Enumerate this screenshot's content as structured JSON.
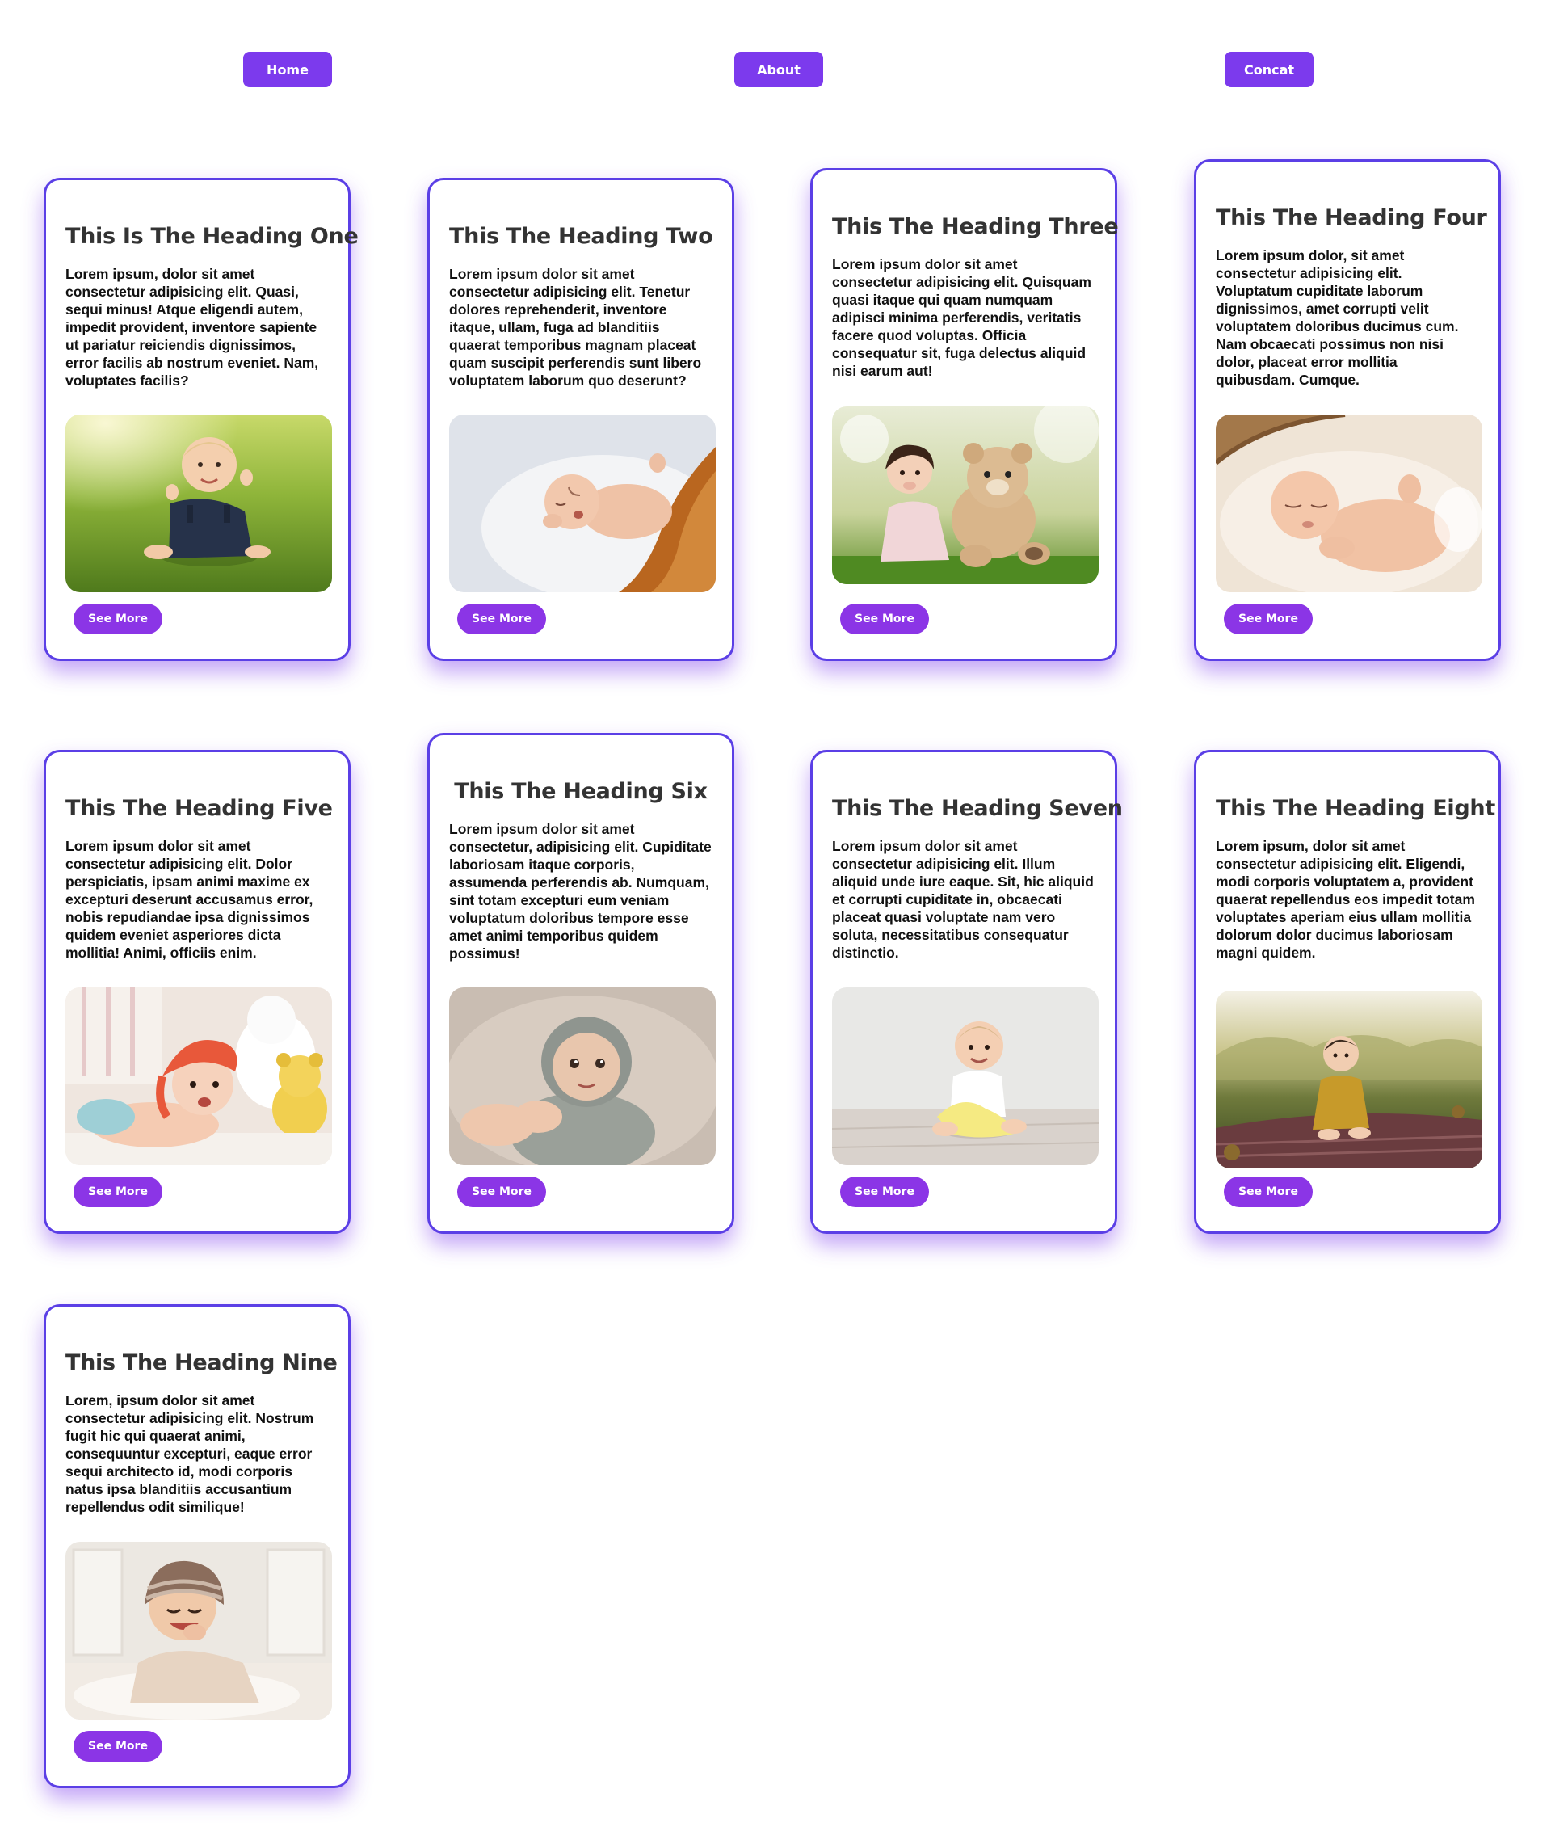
{
  "nav": {
    "home_label": "Home",
    "about_label": "About",
    "contact_label": "Concat"
  },
  "colors": {
    "accent": "#7c3aed",
    "card_border": "#5b3fe6",
    "card_shadow": "#8b5cf6",
    "heading": "#333333",
    "body_text": "#111111"
  },
  "cards": [
    {
      "heading": "This Is The Heading One",
      "text": "Lorem ipsum, dolor sit amet consectetur adipisicing elit. Quasi, sequi minus! Atque eligendi autem, impedit provident, inventore sapiente ut pariatur reiciendis dignissimos, error facilis ab nostrum eveniet. Nam, voluptates facilis?",
      "button_label": "See More",
      "photo": "baby-sitting-on-grass"
    },
    {
      "heading": "This The Heading Two",
      "text": "Lorem ipsum dolor sit amet consectetur adipisicing elit. Tenetur dolores reprehenderit, inventore itaque, ullam, fuga ad blanditiis quaerat temporibus magnam placeat quam suscipit perferendis sunt libero voluptatem laborum quo deserunt?",
      "button_label": "See More",
      "photo": "newborn-sleeping-on-blanket"
    },
    {
      "heading": "This The Heading Three",
      "text": "Lorem ipsum dolor sit amet consectetur adipisicing elit. Quisquam quasi itaque qui quam numquam adipisci minima perferendis, veritatis facere quod voluptas. Officia consequatur sit, fuga delectus aliquid nisi earum aut!",
      "button_label": "See More",
      "photo": "girl-with-teddy-bear"
    },
    {
      "heading": "This The Heading Four",
      "text": "Lorem ipsum dolor, sit amet consectetur adipisicing elit. Voluptatum cupiditate laborum dignissimos, amet corrupti velit voluptatem doloribus ducimus cum. Nam obcaecati possimus non nisi dolor, placeat error mollitia quibusdam. Cumque.",
      "button_label": "See More",
      "photo": "newborn-in-basket"
    },
    {
      "heading": "This The Heading Five",
      "text": "Lorem ipsum dolor sit amet consectetur adipisicing elit. Dolor perspiciatis, ipsam animi maxime ex excepturi deserunt accusamus error, nobis repudiandae ipsa dignissimos quidem eveniet asperiores dicta mollitia! Animi, officiis enim.",
      "button_label": "See More",
      "photo": "baby-with-headscarf"
    },
    {
      "heading": "This The Heading Six",
      "text": "Lorem ipsum dolor sit amet consectetur, adipisicing elit. Cupiditate laboriosam itaque corporis, assumenda perferendis ab. Numquam, sint totam excepturi eum veniam voluptatum doloribus tempore esse amet animi temporibus quidem possimus!",
      "button_label": "See More",
      "photo": "baby-in-knit-hood"
    },
    {
      "heading": "This The Heading Seven",
      "text": "Lorem ipsum dolor sit amet consectetur adipisicing elit. Illum aliquid unde iure eaque. Sit, hic aliquid et corrupti cupiditate in, obcaecati placeat quasi voluptate nam vero soluta, necessitatibus consequatur distinctio.",
      "button_label": "See More",
      "photo": "baby-on-floor-with-toy"
    },
    {
      "heading": "This The Heading Eight",
      "text": "Lorem ipsum, dolor sit amet consectetur adipisicing elit. Eligendi, modi corporis voluptatem a, provident quaerat repellendus eos impedit totam voluptates aperiam eius ullam mollitia dolorum dolor ducimus laboriosam magni quidem.",
      "button_label": "See More",
      "photo": "baby-on-picnic-blanket"
    },
    {
      "heading": "This The Heading Nine",
      "text": "Lorem, ipsum dolor sit amet consectetur adipisicing elit. Nostrum fugit hic qui quaerat animi, consequuntur excepturi, eaque error sequi architecto id, modi corporis natus ipsa blanditiis accusantium repellendus odit similique!",
      "button_label": "See More",
      "photo": "smiling-baby-in-beanie"
    }
  ]
}
